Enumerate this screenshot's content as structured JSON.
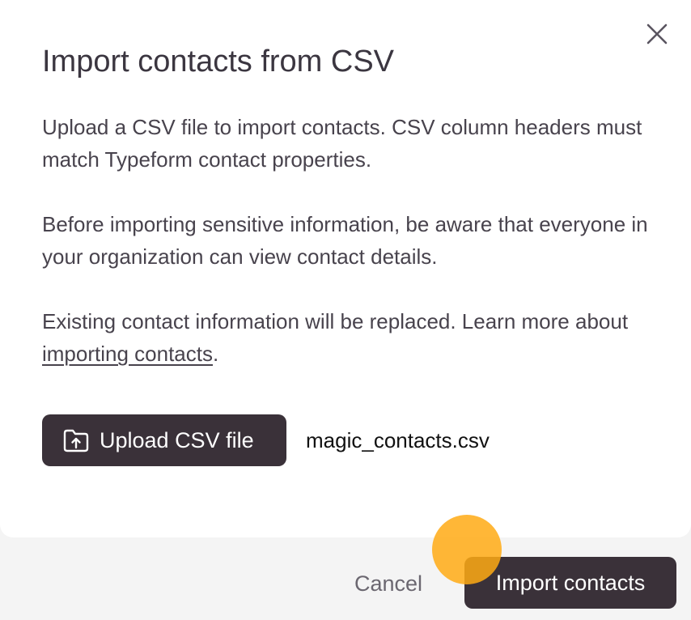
{
  "dialog": {
    "title": "Import contacts from CSV",
    "paragraph_1": "Upload a CSV file to import contacts. CSV column headers must match Typeform contact properties.",
    "paragraph_2": "Before importing sensitive information, be aware that everyone in your organization can view contact details.",
    "paragraph_3_prefix": "Existing contact information will be replaced. Learn more about ",
    "paragraph_3_link": "importing contacts",
    "paragraph_3_suffix": "."
  },
  "upload": {
    "button_label": "Upload CSV file",
    "icon": "folder-upload-icon",
    "selected_file": "magic_contacts.csv"
  },
  "footer": {
    "cancel_label": "Cancel",
    "import_label": "Import contacts"
  },
  "icons": {
    "close": "close-icon"
  },
  "colors": {
    "primary_button": "#3a3139",
    "text": "#48434d",
    "footer_background": "#f4f4f4",
    "cursor_highlight": "#ffaa14"
  }
}
